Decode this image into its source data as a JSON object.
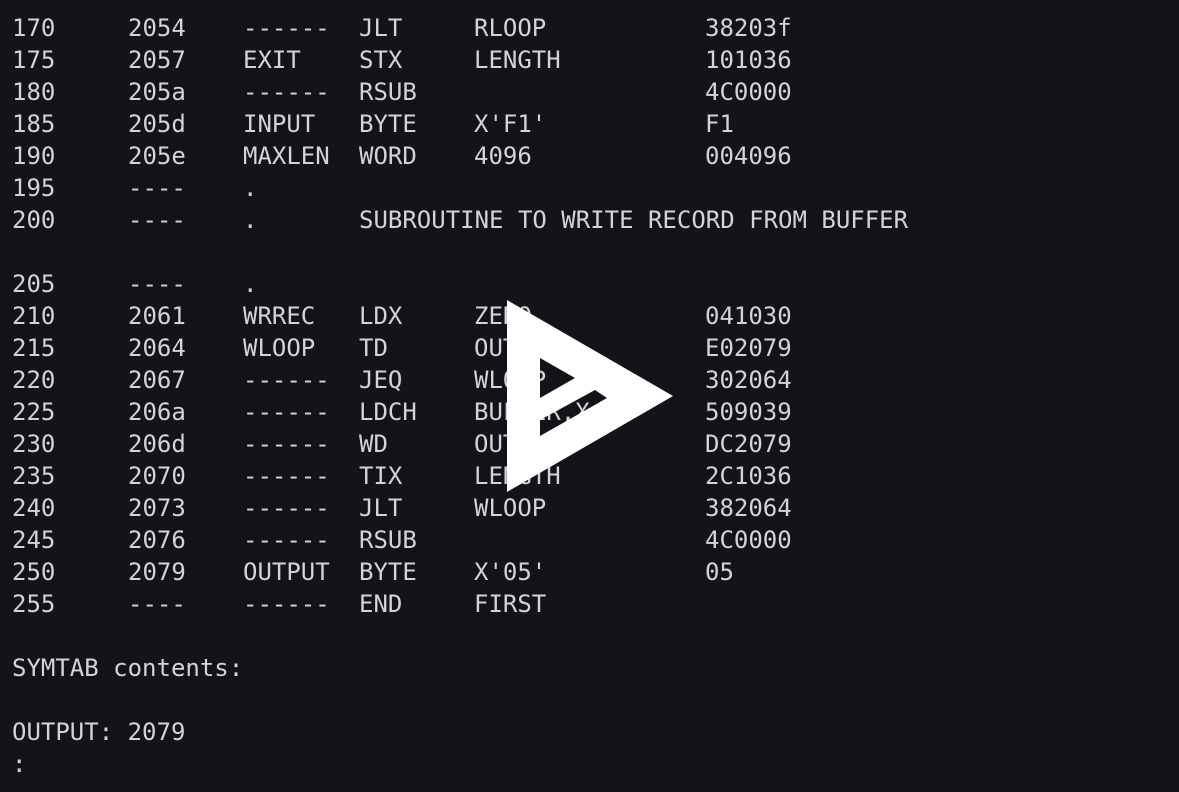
{
  "listing": {
    "rows": [
      {
        "line": "170",
        "loc": "2054",
        "label": "------",
        "opcode": "JLT",
        "operand": "RLOOP",
        "objcode": "38203f"
      },
      {
        "line": "175",
        "loc": "2057",
        "label": "EXIT",
        "opcode": "STX",
        "operand": "LENGTH",
        "objcode": "101036"
      },
      {
        "line": "180",
        "loc": "205a",
        "label": "------",
        "opcode": "RSUB",
        "operand": "",
        "objcode": "4C0000"
      },
      {
        "line": "185",
        "loc": "205d",
        "label": "INPUT",
        "opcode": "BYTE",
        "operand": "X'F1'",
        "objcode": "F1"
      },
      {
        "line": "190",
        "loc": "205e",
        "label": "MAXLEN",
        "opcode": "WORD",
        "operand": "4096",
        "objcode": "004096"
      },
      {
        "line": "195",
        "loc": "----",
        "label": ".",
        "opcode": "",
        "operand": "",
        "objcode": ""
      },
      {
        "line": "200",
        "loc": "----",
        "label": ".",
        "opcode": "SUBROUTINE TO WRITE RECORD FROM BUFFER",
        "operand": "",
        "objcode": ""
      },
      {
        "line": "",
        "loc": "",
        "label": "",
        "opcode": "",
        "operand": "",
        "objcode": ""
      },
      {
        "line": "205",
        "loc": "----",
        "label": ".",
        "opcode": "",
        "operand": "",
        "objcode": ""
      },
      {
        "line": "210",
        "loc": "2061",
        "label": "WRREC",
        "opcode": "LDX",
        "operand": "ZERO",
        "objcode": "041030"
      },
      {
        "line": "215",
        "loc": "2064",
        "label": "WLOOP",
        "opcode": "TD",
        "operand": "OUTPUT",
        "objcode": "E02079"
      },
      {
        "line": "220",
        "loc": "2067",
        "label": "------",
        "opcode": "JEQ",
        "operand": "WLOOP",
        "objcode": "302064"
      },
      {
        "line": "225",
        "loc": "206a",
        "label": "------",
        "opcode": "LDCH",
        "operand": "BUFFER,X",
        "objcode": "509039"
      },
      {
        "line": "230",
        "loc": "206d",
        "label": "------",
        "opcode": "WD",
        "operand": "OUTPUT",
        "objcode": "DC2079"
      },
      {
        "line": "235",
        "loc": "2070",
        "label": "------",
        "opcode": "TIX",
        "operand": "LENGTH",
        "objcode": "2C1036"
      },
      {
        "line": "240",
        "loc": "2073",
        "label": "------",
        "opcode": "JLT",
        "operand": "WLOOP",
        "objcode": "382064"
      },
      {
        "line": "245",
        "loc": "2076",
        "label": "------",
        "opcode": "RSUB",
        "operand": "",
        "objcode": "4C0000"
      },
      {
        "line": "250",
        "loc": "2079",
        "label": "OUTPUT",
        "opcode": "BYTE",
        "operand": "X'05'",
        "objcode": "05"
      },
      {
        "line": "255",
        "loc": "----",
        "label": "------",
        "opcode": "END",
        "operand": "FIRST",
        "objcode": ""
      }
    ]
  },
  "symtab": {
    "heading": "SYMTAB contents:",
    "entry": "OUTPUT: 2079"
  },
  "prompt": ":",
  "overlay_icon": "play-logo-icon"
}
